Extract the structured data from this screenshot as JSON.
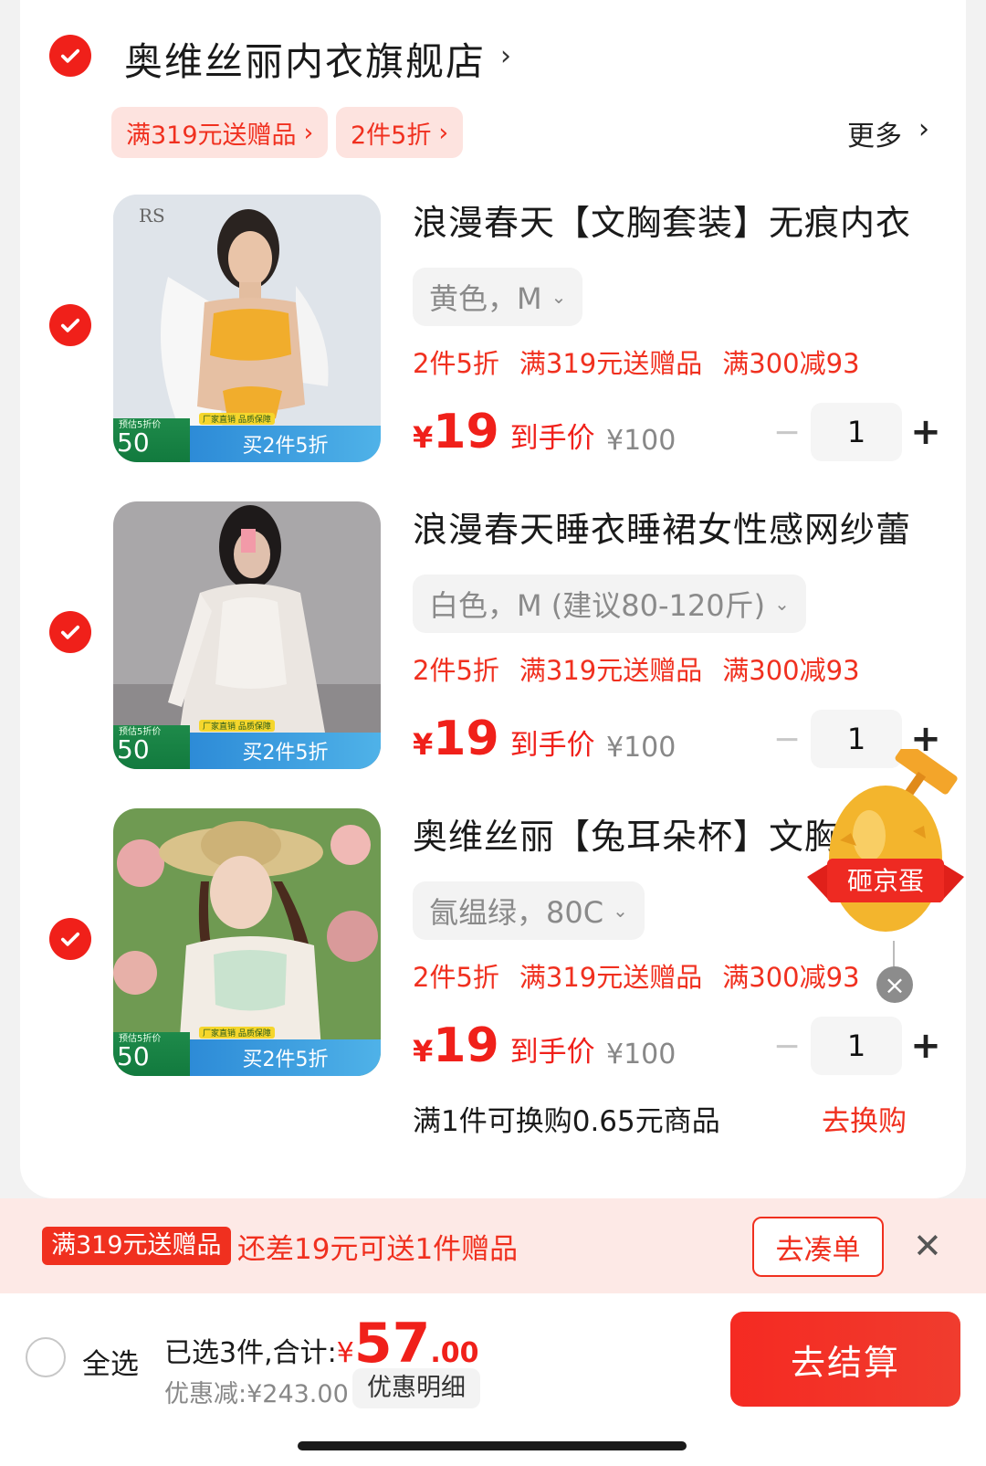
{
  "store": {
    "name": "奥维丝丽内衣旗舰店",
    "chevron": "›"
  },
  "store_promos": [
    "满319元送赠品",
    "2件5折"
  ],
  "more_label": "更多",
  "items": [
    {
      "title": "浪漫春天【文胸套装】无痕内衣",
      "spec": "黄色，M",
      "promos": [
        "2件5折",
        "满319元送赠品",
        "满300减93"
      ],
      "price": "19",
      "price_tag": "到手价",
      "original": "¥100",
      "qty": "1",
      "badge_price": "50",
      "badge_note": "预估5折价",
      "badge_promo": "买2件5折",
      "badge_ribbon": "厂家直销 品质保障"
    },
    {
      "title": "浪漫春天睡衣睡裙女性感网纱蕾",
      "spec": "白色，M (建议80-120斤)",
      "promos": [
        "2件5折",
        "满319元送赠品",
        "满300减93"
      ],
      "price": "19",
      "price_tag": "到手价",
      "original": "¥100",
      "qty": "1",
      "badge_price": "50",
      "badge_note": "预估5折价",
      "badge_promo": "买2件5折",
      "badge_ribbon": "厂家直销 品质保障"
    },
    {
      "title": "奥维丝丽【兔耳朵杯】文胸",
      "spec": "氤缊绿，80C",
      "promos": [
        "2件5折",
        "满319元送赠品",
        "满300减93"
      ],
      "price": "19",
      "price_tag": "到手价",
      "original": "¥100",
      "qty": "1",
      "badge_price": "50",
      "badge_note": "预估5折价",
      "badge_promo": "买2件5折",
      "badge_ribbon": "厂家直销 品质保障"
    }
  ],
  "swap": {
    "text": "满1件可换购0.65元商品",
    "link": "去换购"
  },
  "egg": {
    "label": "砸京蛋"
  },
  "notice": {
    "chip": "满319元送赠品",
    "message": "还差19元可送1件赠品",
    "button": "去凑单"
  },
  "footer": {
    "select_all": "全选",
    "selected_label": "已选3件,合计:",
    "currency": "¥",
    "total_int": "57",
    "total_dec": ".00",
    "discount": "优惠减:¥243.00",
    "detail_btn": "优惠明细",
    "checkout": "去结算"
  },
  "colors": {
    "accent": "#f0201a",
    "promo_bg": "#fde3df",
    "notice_bg": "#fde9e6"
  }
}
